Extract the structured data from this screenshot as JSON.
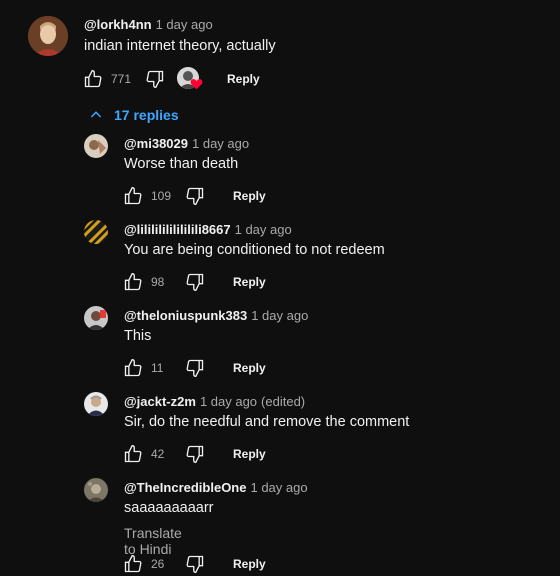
{
  "top_comment": {
    "author": "@lorkh4nn",
    "time": "1 day ago",
    "text": "indian internet theory, actually",
    "likes": "771",
    "reply_label": "Reply",
    "hearted": true
  },
  "replies_toggle": {
    "label": "17 replies"
  },
  "replies": [
    {
      "author": "@mi38029",
      "time": "1 day ago",
      "edited": "",
      "text": "Worse than death",
      "likes": "109",
      "reply_label": "Reply"
    },
    {
      "author": "@lilililililililili8667",
      "time": "1 day ago",
      "edited": "",
      "text": "You are being conditioned to not redeem",
      "likes": "98",
      "reply_label": "Reply"
    },
    {
      "author": "@theloniuspunk383",
      "time": "1 day ago",
      "edited": "",
      "text": "This",
      "likes": "11",
      "reply_label": "Reply"
    },
    {
      "author": "@jackt-z2m",
      "time": "1 day ago",
      "edited": "(edited)",
      "text": "Sir, do the needful and remove the comment",
      "likes": "42",
      "reply_label": "Reply"
    },
    {
      "author": "@TheIncredibleOne",
      "time": "1 day ago",
      "edited": "",
      "text": "saaaaaaaaarr",
      "translate": "Translate to Hindi",
      "likes": "26",
      "reply_label": "Reply"
    }
  ],
  "colors": {
    "background": "#0f0f0f",
    "link": "#3ea6ff",
    "heart": "#ff0033",
    "muted": "#aaaaaa"
  }
}
